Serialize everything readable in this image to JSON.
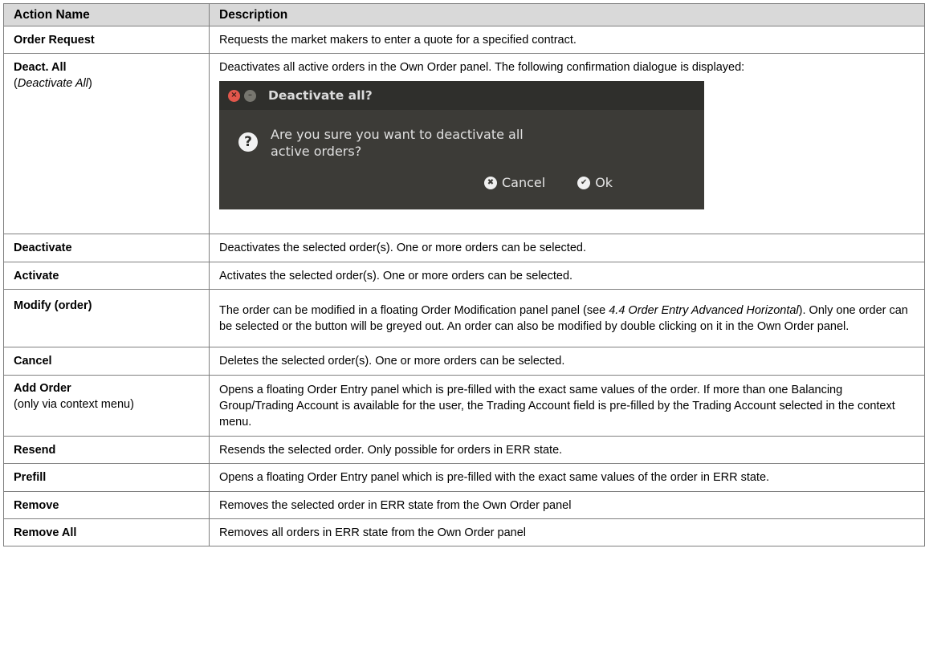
{
  "header": {
    "col_name": "Action Name",
    "col_desc": "Description"
  },
  "rows": [
    {
      "name": "Order Request",
      "desc": "Requests the market makers to enter a quote for a specified contract."
    },
    {
      "name": "Deact. All",
      "sub_open": "(",
      "sub_italic": "Deactivate All",
      "sub_close": ")",
      "desc": "Deactivates all active orders in the Own Order panel. The following confirmation dialogue is displayed:"
    },
    {
      "name": "Deactivate",
      "desc": "Deactivates the selected order(s). One or more orders can be selected."
    },
    {
      "name": "Activate",
      "desc": "Activates the selected order(s). One or more orders can be selected."
    },
    {
      "name": "Modify (order)",
      "desc_a": "The order can be modified in a floating Order Modification panel panel (see ",
      "desc_italic": "4.4 Order Entry Advanced Horizontal",
      "desc_b": "). Only one order can be selected or the button will be greyed out. An order can also be modified by double clicking on it in the Own Order panel."
    },
    {
      "name": "Cancel",
      "desc": "Deletes the selected order(s). One or more orders can be selected."
    },
    {
      "name": "Add Order",
      "sub": "(only via context menu)",
      "desc": "Opens a floating Order Entry panel which is pre-filled with the exact same values of the order. If more than one Balancing Group/Trading Account is available for the user, the Trading Account field is pre-filled by the Trading Account selected in the context menu."
    },
    {
      "name": "Resend",
      "desc": "Resends the selected order. Only possible for orders in ERR state."
    },
    {
      "name": "Prefill",
      "desc": "Opens a floating Order Entry panel which is pre-filled with the exact same values of the order in ERR state."
    },
    {
      "name": "Remove",
      "desc": "Removes the selected order in ERR state from the Own Order panel"
    },
    {
      "name": "Remove All",
      "desc": "Removes all orders in ERR state from the Own Order panel"
    }
  ],
  "dialog": {
    "title": "Deactivate all?",
    "message": "Are you sure you want to deactivate all active orders?",
    "cancel_label": "Cancel",
    "ok_label": "Ok",
    "close_glyph": "×",
    "min_glyph": "–",
    "question_glyph": "?",
    "cancel_glyph": "✖",
    "ok_glyph": "✔",
    "bg_color": "#3c3b37",
    "close_color": "#e2574c"
  },
  "colors": {
    "header_bg": "#d9d9d9",
    "border": "#7f7f7f"
  }
}
